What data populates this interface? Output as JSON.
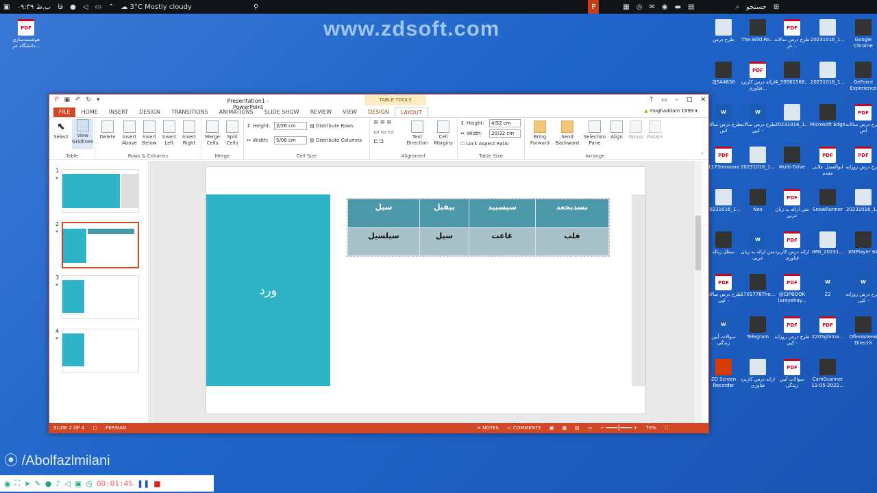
{
  "taskbar": {
    "clock": "۰۹:۴۹ ب.ظ",
    "lang": "فا",
    "weather": "3°C  Mostly cloudy",
    "search": "جستجو"
  },
  "watermark": "www.zdsoft.com",
  "desktop_icons": [
    {
      "label": "هوشمندسازی دانشگاه عر...",
      "type": "pdf",
      "icon": "PDF"
    },
    {
      "label": "طرح درس",
      "type": "img",
      "icon": ""
    },
    {
      "label": "The.Wild.Ro...",
      "type": "app",
      "icon": ""
    },
    {
      "label": "طرح درس سالانه عر...",
      "type": "pdf",
      "icon": "PDF"
    },
    {
      "label": "20231016_1...",
      "type": "img",
      "icon": ""
    },
    {
      "label": "Google Chrome",
      "type": "app",
      "icon": ""
    },
    {
      "label": "2J5A4836",
      "type": "app",
      "icon": ""
    },
    {
      "label": "ارائه درس کاربرد فناوری...",
      "type": "pdf",
      "icon": "PDF"
    },
    {
      "label": "4_59561568...",
      "type": "app",
      "icon": ""
    },
    {
      "label": "20231016_1...",
      "type": "img",
      "icon": ""
    },
    {
      "label": "GeForce Experience",
      "type": "app",
      "icon": ""
    },
    {
      "label": "طرح درس سالانه اس",
      "type": "word",
      "icon": "W"
    },
    {
      "label": "طرح درس سالانه - کپی",
      "type": "word",
      "icon": "W"
    },
    {
      "label": "20231016_1...",
      "type": "img",
      "icon": ""
    },
    {
      "label": "Microsoft Edge",
      "type": "app",
      "icon": ""
    },
    {
      "label": "طرح درس سالانه اس",
      "type": "pdf",
      "icon": "PDF"
    },
    {
      "label": "1173mosana",
      "type": "pdf",
      "icon": "PDF"
    },
    {
      "label": "20231016_1...",
      "type": "img",
      "icon": ""
    },
    {
      "label": "Multi-Drive",
      "type": "app",
      "icon": ""
    },
    {
      "label": "ابوالفضل علایی مقدم",
      "type": "pdf",
      "icon": "PDF"
    },
    {
      "label": "طرح درس روزانه",
      "type": "pdf",
      "icon": "PDF"
    },
    {
      "label": "20231016_1...",
      "type": "img",
      "icon": ""
    },
    {
      "label": "Nox",
      "type": "app",
      "icon": ""
    },
    {
      "label": "متن ارائه به زبان عربی",
      "type": "pdf",
      "icon": "PDF"
    },
    {
      "label": "SnowRunner",
      "type": "app",
      "icon": ""
    },
    {
      "label": "20231016_1...",
      "type": "img",
      "icon": ""
    },
    {
      "label": "سطل زباله",
      "type": "app",
      "icon": ""
    },
    {
      "label": "متن ارائه به زبان عربی",
      "type": "word",
      "icon": "W"
    },
    {
      "label": "ارائه درس کاربرد فناوری",
      "type": "pdf",
      "icon": "PDF"
    },
    {
      "label": "IMG_20231...",
      "type": "img",
      "icon": ""
    },
    {
      "label": "KMPlayer 64",
      "type": "app",
      "icon": ""
    },
    {
      "label": "طرح درس سالانه - کپی",
      "type": "pdf",
      "icon": "PDF"
    },
    {
      "label": "1701778The...",
      "type": "app",
      "icon": ""
    },
    {
      "label": "@CIPBOOK (arayehay...",
      "type": "pdf",
      "icon": "PDF"
    },
    {
      "label": "22",
      "type": "word",
      "icon": "W"
    },
    {
      "label": "طرح درس روزانه - کپی",
      "type": "word",
      "icon": "W"
    },
    {
      "label": "سوالات آیین زندگی",
      "type": "word",
      "icon": "W"
    },
    {
      "label": "Telegram",
      "type": "app",
      "icon": ""
    },
    {
      "label": "طرح درس روزانه - کپی",
      "type": "pdf",
      "icon": "PDF"
    },
    {
      "label": "2205ghima...",
      "type": "pdf",
      "icon": "PDF"
    },
    {
      "label": "Обновлени DirectX",
      "type": "app",
      "icon": ""
    },
    {
      "label": "ZD Screen Recorder",
      "type": "cam",
      "icon": ""
    },
    {
      "label": "ارائه درس کاربرد فناوری",
      "type": "img",
      "icon": ""
    },
    {
      "label": "سوالات آیین زندگی",
      "type": "pdf",
      "icon": "PDF"
    },
    {
      "label": "CamScanner 11-05-2022...",
      "type": "app",
      "icon": ""
    }
  ],
  "recorder": {
    "handle": "/Abolfazlmilani",
    "time": "00:01:45"
  },
  "window": {
    "title": "Presentation1 - PowerPoint",
    "user": "moghaddam 1999",
    "context_tab": "TABLE TOOLS",
    "tabs": [
      "FILE",
      "HOME",
      "INSERT",
      "DESIGN",
      "TRANSITIONS",
      "ANIMATIONS",
      "SLIDE SHOW",
      "REVIEW",
      "VIEW",
      "DESIGN",
      "LAYOUT"
    ],
    "selected_tab": "LAYOUT"
  },
  "ribbon": {
    "table": {
      "label": "Table",
      "select": "Select",
      "view_gridlines": "View Gridlines"
    },
    "rows_cols": {
      "label": "Rows & Columns",
      "delete": "Delete",
      "insert_above": "Insert Above",
      "insert_below": "Insert Below",
      "insert_left": "Insert Left",
      "insert_right": "Insert Right"
    },
    "merge": {
      "label": "Merge",
      "merge_cells": "Merge Cells",
      "split_cells": "Split Cells"
    },
    "cell_size": {
      "label": "Cell Size",
      "height_label": "Height:",
      "height": "2/26 cm",
      "width_label": "Width:",
      "width": "5/08 cm",
      "distribute_rows": "Distribute Rows",
      "distribute_columns": "Distribute Columns"
    },
    "alignment": {
      "label": "Alignment",
      "text_direction": "Text Direction",
      "cell_margins": "Cell Margins"
    },
    "table_size": {
      "label": "Table Size",
      "height_label": "Height:",
      "height": "4/52 cm",
      "width_label": "Width:",
      "width": "20/32 cm",
      "lock": "Lock Aspect Ratio"
    },
    "arrange": {
      "label": "Arrange",
      "bring_forward": "Bring Forward",
      "send_backward": "Send Backward",
      "selection_pane": "Selection Pane",
      "align": "Align",
      "group": "Group",
      "rotate": "Rotate"
    }
  },
  "thumbnails": [
    {
      "num": "1",
      "star": "*"
    },
    {
      "num": "2",
      "star": "*"
    },
    {
      "num": "3",
      "star": "*"
    },
    {
      "num": "4",
      "star": "*"
    }
  ],
  "slide": {
    "box_text": "ورد",
    "table": {
      "header": [
        "بسدبحعد",
        "سیسبید",
        "بیقبل",
        "سیل"
      ],
      "row": [
        "قلب",
        "غاعت",
        "سیل",
        "سیلسیل"
      ]
    }
  },
  "statusbar": {
    "slide": "SLIDE 2 OF 4",
    "lang": "PERSIAN",
    "notes": "NOTES",
    "comments": "COMMENTS",
    "zoom": "76%"
  },
  "colors": {
    "accent": "#d24726",
    "teal": "#2fb3c7",
    "desktop": "#1f64c9"
  }
}
